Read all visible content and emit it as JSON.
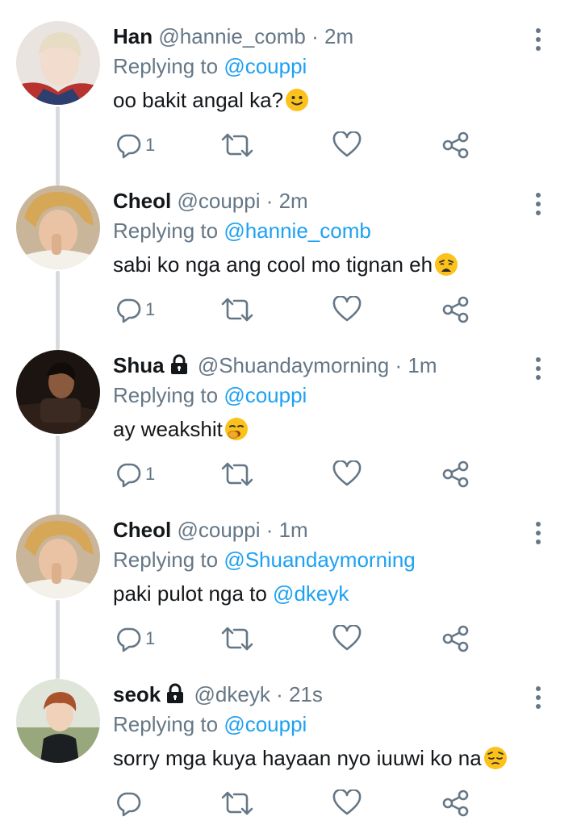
{
  "tweets": [
    {
      "name": "Han",
      "handle": "@hannie_comb",
      "time": "· 2m",
      "replying_prefix": "Replying to",
      "replying_to": "@couppi",
      "text": "oo bakit angal ka?",
      "emoji": "slightly-smiling-face",
      "reply_count": "1",
      "locked": false
    },
    {
      "name": "Cheol",
      "handle": "@couppi",
      "time": "· 2m",
      "replying_prefix": "Replying to",
      "replying_to": "@hannie_comb",
      "text": "sabi ko nga ang cool mo tignan eh",
      "emoji": "weary-face",
      "reply_count": "1",
      "locked": false
    },
    {
      "name": "Shua",
      "handle": "@Shuandaymorning",
      "time": "· 1m",
      "replying_prefix": "Replying to",
      "replying_to": "@couppi",
      "text": "ay weakshit",
      "emoji": "yawning-face",
      "reply_count": "1",
      "locked": true
    },
    {
      "name": "Cheol",
      "handle": "@couppi",
      "time": "· 1m",
      "replying_prefix": "Replying to",
      "replying_to": "@Shuandaymorning",
      "text": "paki pulot nga to ",
      "text_mention": "@dkeyk",
      "reply_count": "1",
      "locked": false
    },
    {
      "name": "seok",
      "handle": "@dkeyk",
      "time": "· 21s",
      "replying_prefix": "Replying to",
      "replying_to": "@couppi",
      "text": "sorry mga kuya hayaan nyo iuuwi ko na",
      "emoji": "pensive-face",
      "reply_count": "",
      "locked": true
    }
  ],
  "colors": {
    "mention": "#1da1f2",
    "secondary_text": "#657786",
    "primary_text": "#14171a",
    "thread_line": "#d7dbde"
  }
}
